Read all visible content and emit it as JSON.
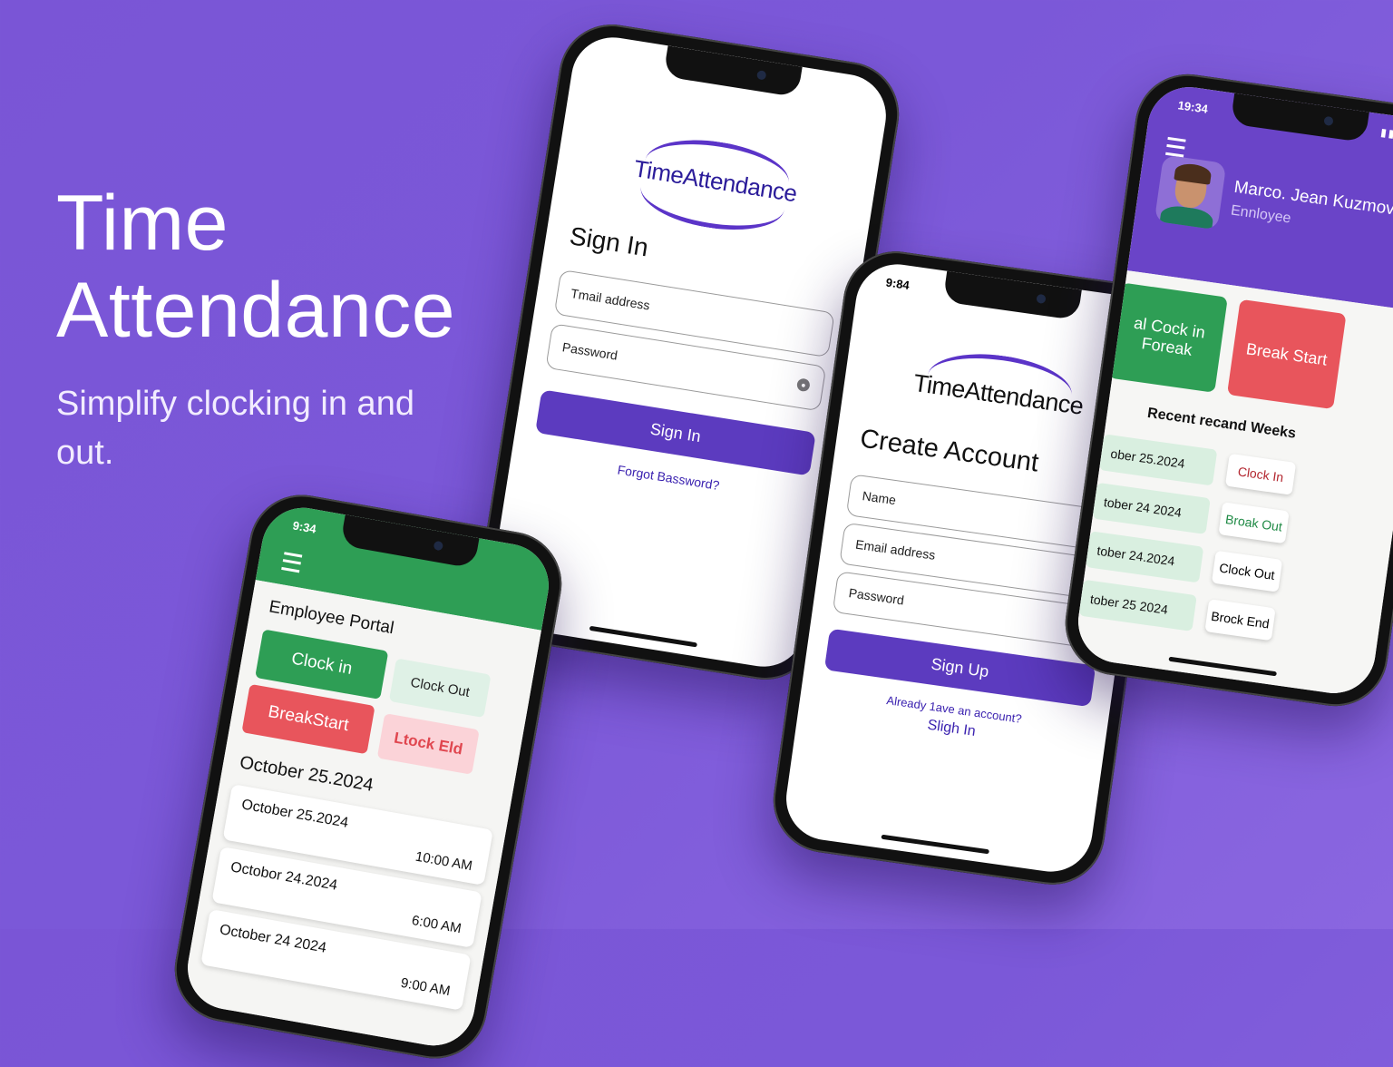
{
  "hero": {
    "title_line1": "Time",
    "title_line2": "Attendance",
    "subtitle": "Simplify clocking in and out."
  },
  "brand": {
    "logo_text": "TimeAttendance",
    "accent": "#5c3bbf",
    "green": "#2e9e55",
    "red": "#e8555c"
  },
  "signin": {
    "title": "Sign In",
    "email_placeholder": "Tmail address",
    "password_placeholder": "Password",
    "button": "Sign In",
    "forgot_link": "Forgot Bassword?"
  },
  "signup": {
    "status_time": "9:84",
    "title": "Create Account",
    "name_placeholder": "Name",
    "email_placeholder": "Email address",
    "password_placeholder": "Password",
    "button": "Sign Up",
    "prompt": "Already 1ave an account?",
    "signin_link": "Sligh In"
  },
  "portal": {
    "status_time": "9:34",
    "title": "Employee Portal",
    "buttons": {
      "clock_in": "Clock in",
      "clock_out": "Clock Out",
      "break_start": "BreakStart",
      "clock_end": "Ltock Eld"
    },
    "section_date": "October 25.2024",
    "entries": [
      {
        "date": "October 25.2024",
        "time": "10:00 AM"
      },
      {
        "date": "Octobor 24.2024",
        "time": "6:00 AM"
      },
      {
        "date": "October 24 2024",
        "time": "9:00 AM"
      }
    ]
  },
  "profile": {
    "status_time": "19:34",
    "name": "Marco. Jean Kuzmov",
    "role": "Ennloyee",
    "clock_btn": "al Cock in Foreak",
    "break_btn": "Break Start",
    "recent_title": "Recent recand Weeks",
    "records": [
      {
        "date": "ober 25.2024",
        "tag": "Clock In",
        "tag_color": "#b3262f"
      },
      {
        "date": "tober 24 2024",
        "tag": "Broak Out",
        "tag_color": "#1f8a45"
      },
      {
        "date": "tober 24.2024",
        "tag": "Clock Out",
        "tag_color": "#111111"
      },
      {
        "date": "tober 25 2024",
        "tag": "Brock End",
        "tag_color": "#111111"
      }
    ]
  }
}
